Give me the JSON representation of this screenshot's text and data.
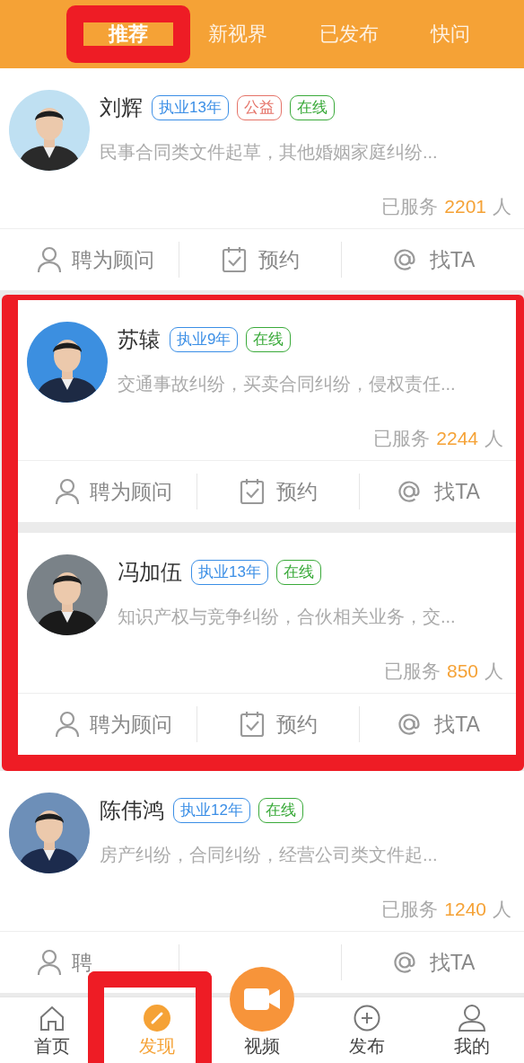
{
  "tabs": [
    {
      "label": "推荐",
      "selected": true,
      "highlighted": true
    },
    {
      "label": "新视界",
      "selected": false,
      "highlighted": false
    },
    {
      "label": "已发布",
      "selected": false,
      "highlighted": false
    },
    {
      "label": "快问",
      "selected": false,
      "highlighted": false
    }
  ],
  "cards": [
    {
      "avatar": {
        "kind": "picture"
      },
      "name": "刘辉",
      "tags": [
        {
          "kind": "years",
          "label": "执业13年"
        },
        {
          "kind": "charity",
          "label": "公益"
        },
        {
          "kind": "online",
          "label": "在线"
        }
      ],
      "description": "民事合同类文件起草，其他婚姻家庭纠纷...",
      "served_label": "已服务",
      "served_count": "2201",
      "served_unit": "人",
      "highlighted": false,
      "actions": [
        {
          "kind": "hire",
          "label": "聘为顾问"
        },
        {
          "kind": "appoint",
          "label": "预约"
        },
        {
          "kind": "contact",
          "label": "找TA"
        }
      ]
    },
    {
      "avatar": {
        "kind": "picture"
      },
      "name": "苏辕",
      "tags": [
        {
          "kind": "years",
          "label": "执业9年"
        },
        {
          "kind": "online",
          "label": "在线"
        }
      ],
      "description": "交通事故纠纷，买卖合同纠纷，侵权责任...",
      "served_label": "已服务",
      "served_count": "2244",
      "served_unit": "人",
      "highlighted": true,
      "actions": [
        {
          "kind": "hire",
          "label": "聘为顾问"
        },
        {
          "kind": "appoint",
          "label": "预约"
        },
        {
          "kind": "contact",
          "label": "找TA"
        }
      ]
    },
    {
      "avatar": {
        "kind": "picture"
      },
      "name": "冯加伍",
      "tags": [
        {
          "kind": "years",
          "label": "执业13年"
        },
        {
          "kind": "online",
          "label": "在线"
        }
      ],
      "description": "知识产权与竞争纠纷，合伙相关业务，交...",
      "served_label": "已服务",
      "served_count": "850",
      "served_unit": "人",
      "highlighted": true,
      "actions": [
        {
          "kind": "hire",
          "label": "聘为顾问"
        },
        {
          "kind": "appoint",
          "label": "预约"
        },
        {
          "kind": "contact",
          "label": "找TA"
        }
      ]
    },
    {
      "avatar": {
        "kind": "picture"
      },
      "name": "陈伟鸿",
      "tags": [
        {
          "kind": "years",
          "label": "执业12年"
        },
        {
          "kind": "online",
          "label": "在线"
        }
      ],
      "description": "房产纠纷，合同纠纷，经营公司类文件起...",
      "served_label": "已服务",
      "served_count": "1240",
      "served_unit": "人",
      "highlighted": false,
      "actions": [
        {
          "kind": "hire",
          "label": "聘"
        },
        {
          "kind": "contact",
          "label": "找TA"
        }
      ]
    }
  ],
  "bottom_nav": [
    {
      "kind": "home",
      "label": "首页",
      "selected": false,
      "highlighted": false
    },
    {
      "kind": "discover",
      "label": "发现",
      "selected": true,
      "highlighted": true
    },
    {
      "kind": "video",
      "label": "视频",
      "selected": false,
      "highlighted": false
    },
    {
      "kind": "publish",
      "label": "发布",
      "selected": false,
      "highlighted": false
    },
    {
      "kind": "mine",
      "label": "我的",
      "selected": false,
      "highlighted": false
    }
  ]
}
